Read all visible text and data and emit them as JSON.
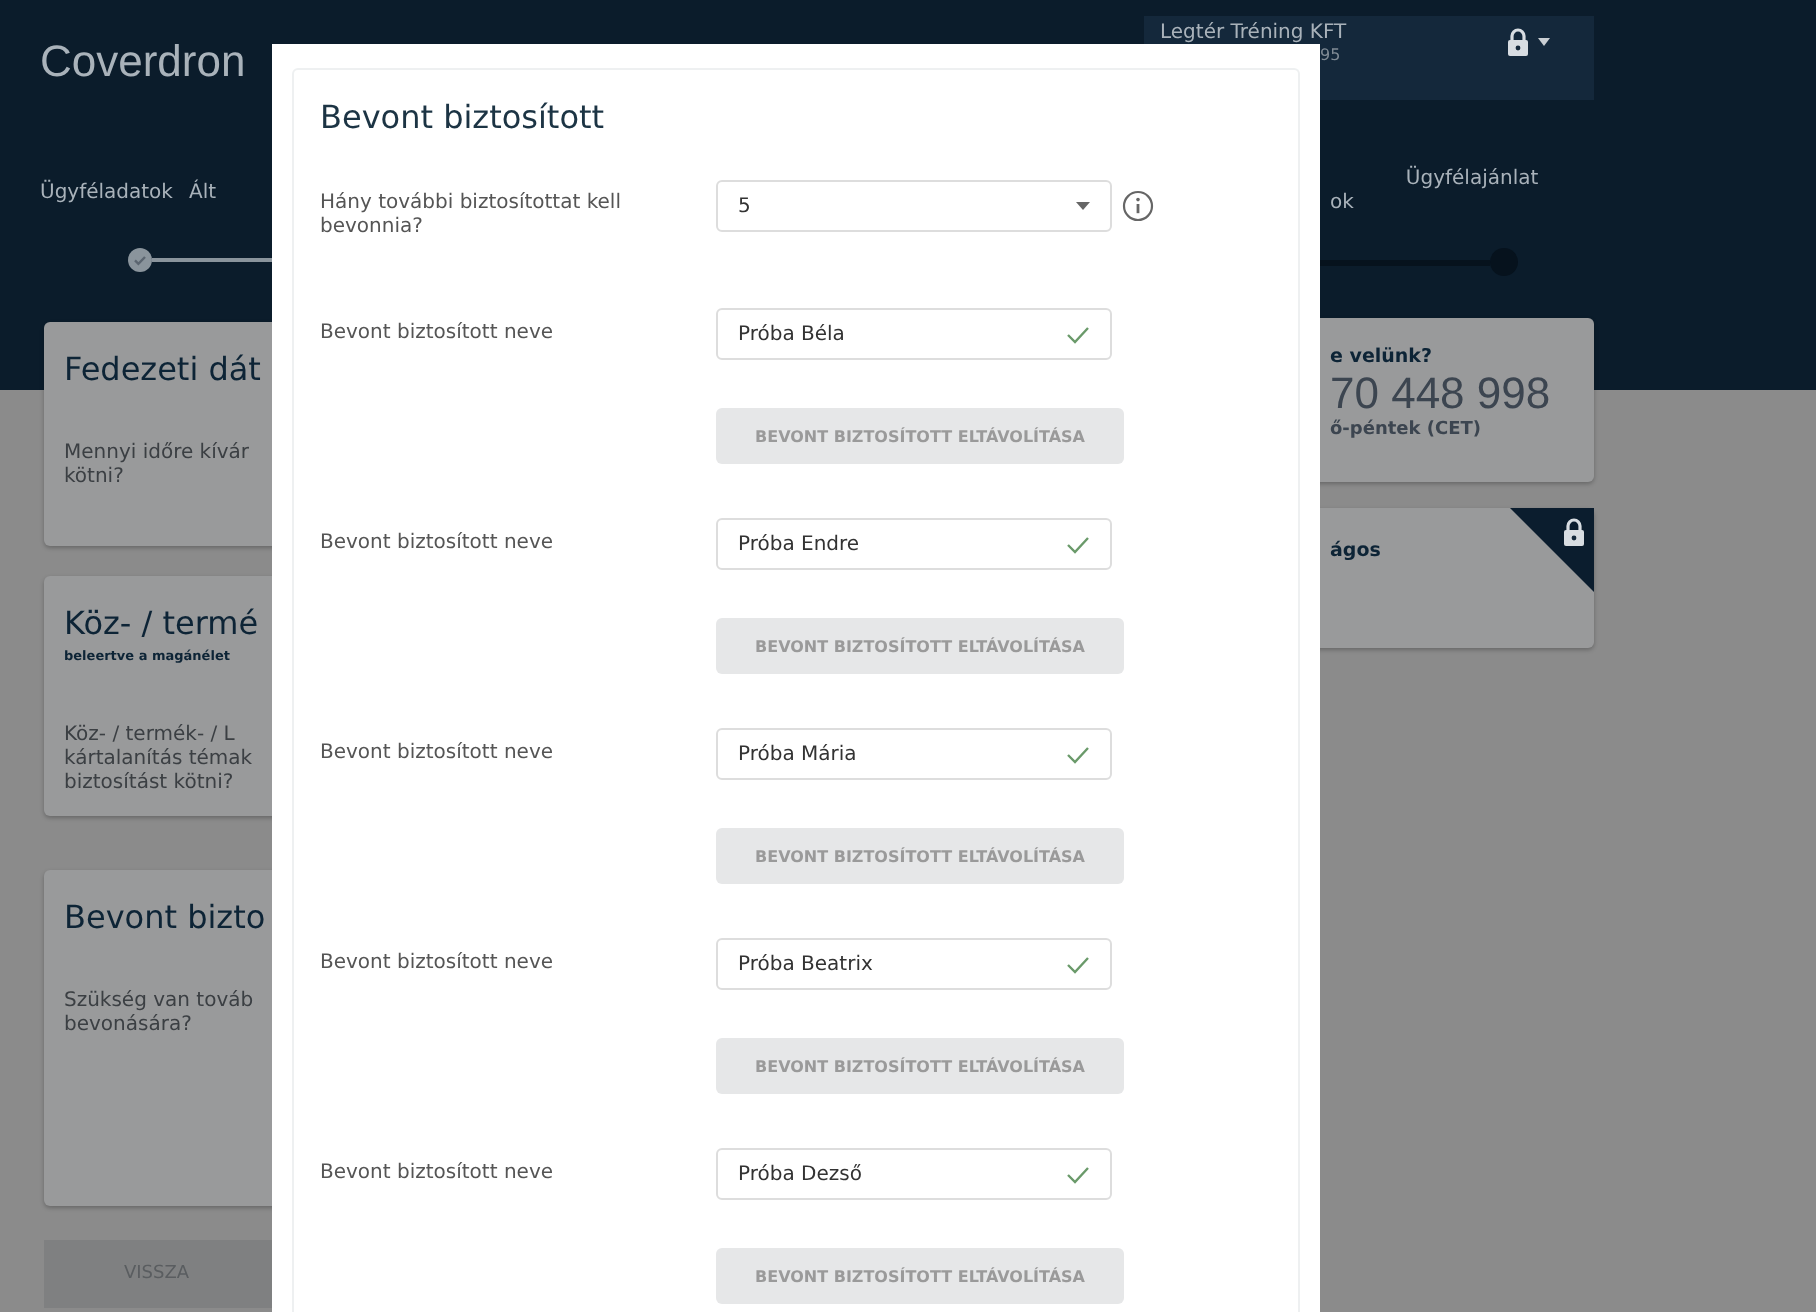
{
  "header": {
    "logo": "Coverdron",
    "account_name": "Legtér Tréning KFT",
    "account_id": "95",
    "nav_left": [
      "Ügyféladatok",
      "Ált"
    ],
    "nav_right": [
      "ok",
      "Ügyfélajánlat"
    ]
  },
  "left_cards": [
    {
      "title": "Fedezeti dát",
      "question": "Mennyi időre kívár\nkötni?"
    },
    {
      "title": "Köz- / termé",
      "subtitle": "beleertve a magánélet",
      "question": "Köz- / termék- / L\nkártalanítás témak\nbiztosítást kötni?"
    },
    {
      "title": "Bevont bizto",
      "question": "Szükség van továb\nbevonására?"
    }
  ],
  "back_button": "VISSZA",
  "right_cards": [
    {
      "kind": "contact",
      "title": "e velünk?",
      "phone": "70 448 998",
      "hours": "ő-péntek (CET)"
    },
    {
      "kind": "locked",
      "title": "ágos"
    }
  ],
  "modal": {
    "title": "Bevont biztosított",
    "count_question": "Hány további biztosítottat kell bevonnia?",
    "count_value": "5",
    "insured": [
      {
        "label": "Bevont biztosított neve",
        "value": "Próba Béla",
        "valid": true,
        "remove_button": "BEVONT BIZTOSÍTOTT ELTÁVOLÍTÁSA"
      },
      {
        "label": "Bevont biztosított neve",
        "value": "Próba Endre",
        "valid": true,
        "remove_button": "BEVONT BIZTOSÍTOTT ELTÁVOLÍTÁSA"
      },
      {
        "label": "Bevont biztosított neve",
        "value": "Próba Mária",
        "valid": true,
        "remove_button": "BEVONT BIZTOSÍTOTT ELTÁVOLÍTÁSA"
      },
      {
        "label": "Bevont biztosított neve",
        "value": "Próba Beatrix",
        "valid": true,
        "remove_button": "BEVONT BIZTOSÍTOTT ELTÁVOLÍTÁSA"
      },
      {
        "label": "Bevont biztosított neve",
        "value": "Próba Dezső",
        "valid": true,
        "remove_button": "BEVONT BIZTOSÍTOTT ELTÁVOLÍTÁSA"
      }
    ]
  }
}
